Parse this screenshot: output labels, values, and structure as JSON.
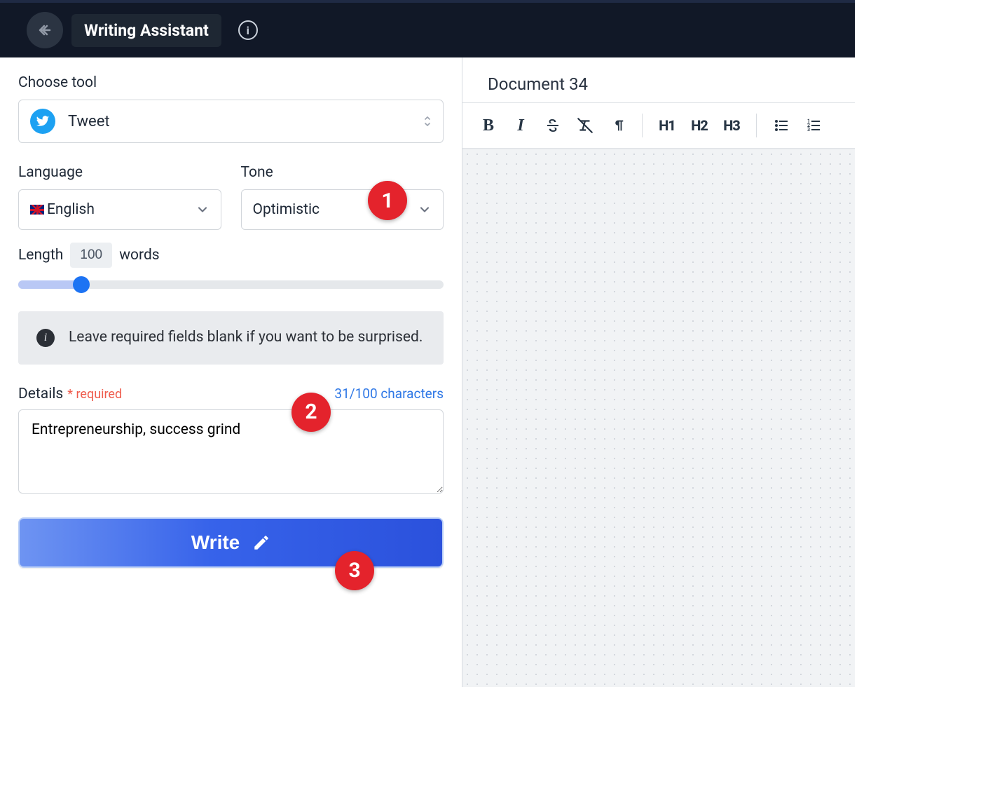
{
  "header": {
    "title": "Writing Assistant"
  },
  "left": {
    "choose_tool_label": "Choose tool",
    "tool_name": "Tweet",
    "language_label": "Language",
    "language_value": "English",
    "tone_label": "Tone",
    "tone_value": "Optimistic",
    "length_label": "Length",
    "length_value": "100",
    "length_unit": "words",
    "info_text": "Leave required fields blank if you want to be surprised.",
    "details_label": "Details",
    "details_required": "* required",
    "details_charcount": "31/100 characters",
    "details_value": "Entrepreneurship, success grind",
    "write_label": "Write"
  },
  "right": {
    "document_title": "Document 34",
    "h1": "H1",
    "h2": "H2",
    "h3": "H3"
  },
  "annotations": {
    "b1": "1",
    "b2": "2",
    "b3": "3"
  }
}
